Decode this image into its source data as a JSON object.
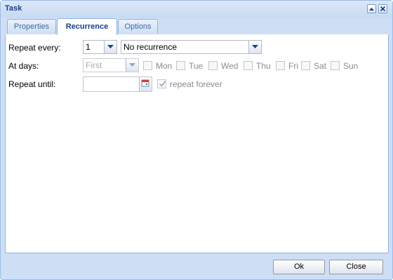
{
  "window": {
    "title": "Task"
  },
  "tabs": [
    {
      "label": "Properties"
    },
    {
      "label": "Recurrence"
    },
    {
      "label": "Options"
    }
  ],
  "form": {
    "repeat_every_label": "Repeat every:",
    "repeat_interval": "1",
    "recurrence_type": "No recurrence",
    "at_days_label": "At days:",
    "ordinal": "First",
    "days": [
      "Mon",
      "Tue",
      "Wed",
      "Thu",
      "Fri",
      "Sat",
      "Sun"
    ],
    "repeat_until_label": "Repeat until:",
    "repeat_until_value": "",
    "repeat_forever_label": "repeat forever",
    "repeat_forever_checked": true
  },
  "buttons": {
    "ok": "Ok",
    "close": "Close"
  }
}
